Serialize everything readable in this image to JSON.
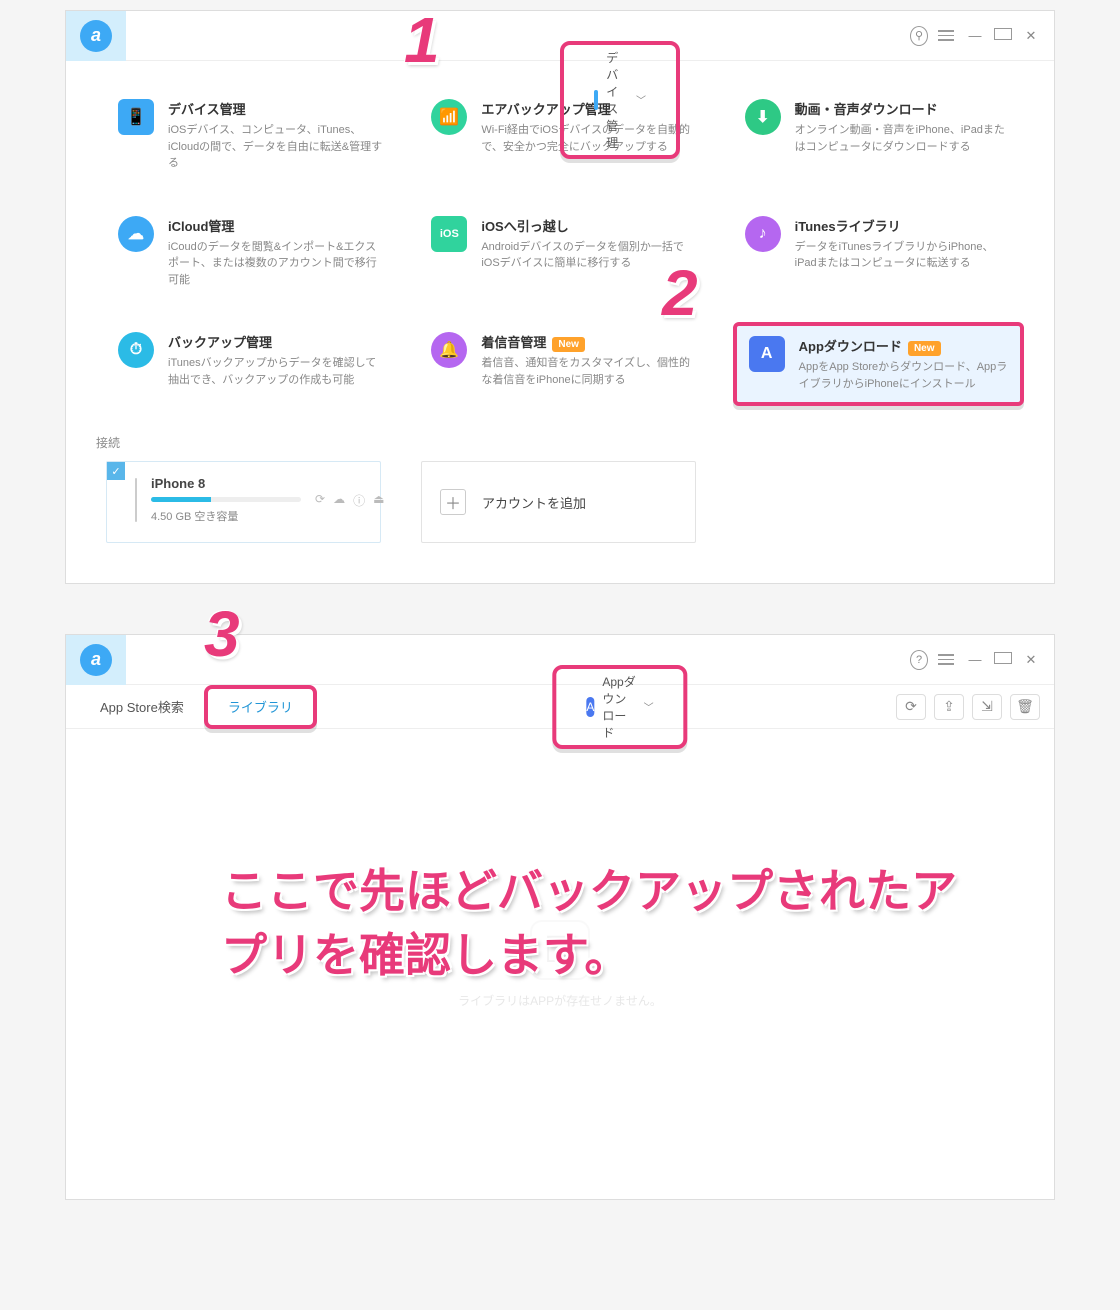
{
  "colors": {
    "accent": "#e83a7a",
    "brand": "#3da9f5",
    "new_badge": "#ffa22b"
  },
  "window1": {
    "logo_letter": "a",
    "nav_title": "デバイス管理",
    "winctl": {
      "search": "⚲",
      "menu": "≡",
      "min": "—",
      "max": "☐",
      "close": "✕"
    },
    "features": [
      {
        "icon": "phone",
        "icon_bg": "#3da9f5",
        "title": "デバイス管理",
        "desc": "iOSデバイス、コンピュータ、iTunes、iCloudの間で、データを自由に転送&管理する"
      },
      {
        "icon": "wifi",
        "icon_bg": "#30d39d",
        "title": "エアバックアップ管理",
        "desc": "Wi-Fi経由でiOSデバイスのデータを自動的で、安全かつ完全にバックアップする"
      },
      {
        "icon": "download",
        "icon_bg": "#2ec985",
        "title": "動画・音声ダウンロード",
        "desc": "オンライン動画・音声をiPhone、iPadまたはコンピュータにダウンロードする"
      },
      {
        "icon": "cloud",
        "icon_bg": "#3da9f5",
        "title": "iCloud管理",
        "desc": "iCoudのデータを閲覧&インポート&エクスポート、または複数のアカウント間で移行可能"
      },
      {
        "icon": "ios",
        "icon_bg": "#30d39d",
        "title": "iOSへ引っ越し",
        "desc": "Androidデバイスのデータを個別か一括でiOSデバイスに簡単に移行する"
      },
      {
        "icon": "music",
        "icon_bg": "#b567f0",
        "title": "iTunesライブラリ",
        "desc": "データをiTunesライブラリからiPhone、iPadまたはコンピュータに転送する"
      },
      {
        "icon": "clock",
        "icon_bg": "#2bbbe6",
        "title": "バックアップ管理",
        "desc": "iTunesバックアップからデータを確認して抽出でき、バックアップの作成も可能"
      },
      {
        "icon": "bell",
        "icon_bg": "#b567f0",
        "title": "着信音管理",
        "badge": "New",
        "desc": "着信音、通知音をカスタマイズし、個性的な着信音をiPhoneに同期する"
      },
      {
        "icon": "app",
        "icon_bg": "#4a78f0",
        "title": "Appダウンロード",
        "badge": "New",
        "desc": "AppをApp Storeからダウンロード、AppライブラリからiPhoneにインストール",
        "highlight": true
      }
    ],
    "connect_label": "接続",
    "device": {
      "name": "iPhone 8",
      "free": "4.50 GB 空き容量"
    },
    "add_account": "アカウントを追加",
    "annotations": {
      "n1": "1",
      "n2": "2"
    }
  },
  "window2": {
    "logo_letter": "a",
    "nav_title": "Appダウンロード",
    "winctl": {
      "help": "?",
      "menu": "≡",
      "min": "—",
      "max": "☐",
      "close": "✕"
    },
    "tabs": [
      {
        "label": "App Store検索",
        "active": false
      },
      {
        "label": "ライブラリ",
        "active": true,
        "highlight": true
      }
    ],
    "toolbar_icons": [
      "refresh",
      "export",
      "import",
      "trash"
    ],
    "empty_msg": "ライブラリはAPPが存在せノません。",
    "annotations": {
      "n3": "3"
    },
    "big_annotation": "ここで先ほどバックアップされたアプリを確認します。"
  }
}
